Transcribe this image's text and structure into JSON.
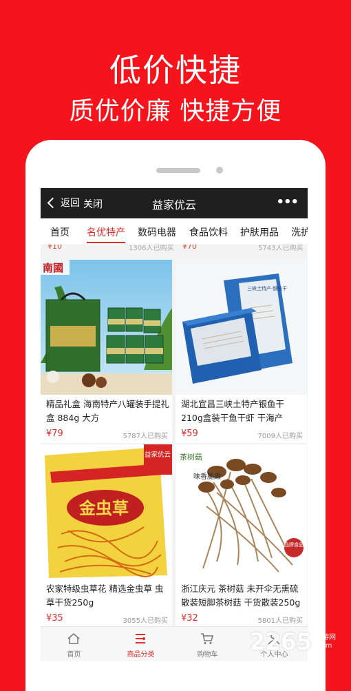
{
  "promo": {
    "headline": "低价快捷",
    "subheadline": "质优价廉 快捷方便"
  },
  "navbar": {
    "back_label": "返回",
    "close_label": "关闭",
    "title": "益家优云",
    "more_label": "•••"
  },
  "category_tabs": [
    {
      "label": "首页",
      "active": false
    },
    {
      "label": "名优特产",
      "active": true
    },
    {
      "label": "数码电器",
      "active": false
    },
    {
      "label": "食品饮料",
      "active": false
    },
    {
      "label": "护肤用品",
      "active": false
    },
    {
      "label": "洗护",
      "active": false
    }
  ],
  "partial_row": {
    "left_price": "¥10",
    "left_sold": "1306人已购买",
    "right_price": "¥70",
    "right_sold": "5743人已购买"
  },
  "products": [
    {
      "title": "精品礼盒 海南特产八罐装手提礼盒 884g 大方",
      "price": "¥79",
      "sold": "5787人已购买",
      "image_label": "南國"
    },
    {
      "title": "湖北宜昌三峡土特产银鱼干210g盒装干鱼干虾 干海产",
      "price": "¥59",
      "sold": "7009人已购买",
      "image_label": "三峡土特产·银鱼干"
    },
    {
      "title": "农家特级虫草花 精选金虫草 虫草干货250g",
      "price": "¥35",
      "sold": "3055人已购买",
      "image_label": "金虫草",
      "badge": "益家优云"
    },
    {
      "title": "浙江庆元 茶树菇 未开伞无熏硫散装短脚茶树菇 干货散装250g",
      "price": "¥32",
      "sold": "5801人已购买",
      "image_label": "茶树菇",
      "image_label2": "味香脆嫩",
      "seal": "品牌食品"
    }
  ],
  "tabbar": [
    {
      "label": "首页",
      "icon": "home-icon",
      "active": false
    },
    {
      "label": "商品分类",
      "icon": "category-icon",
      "active": true
    },
    {
      "label": "购物车",
      "icon": "cart-icon",
      "active": false
    },
    {
      "label": "个人中心",
      "icon": "user-icon",
      "active": false
    }
  ],
  "watermark": {
    "number": "2265",
    "line1": "手游网",
    "line2": ".com"
  },
  "colors": {
    "background_red": "#f5141b",
    "accent": "#e32b2b",
    "navbar": "#1f1f1f"
  }
}
